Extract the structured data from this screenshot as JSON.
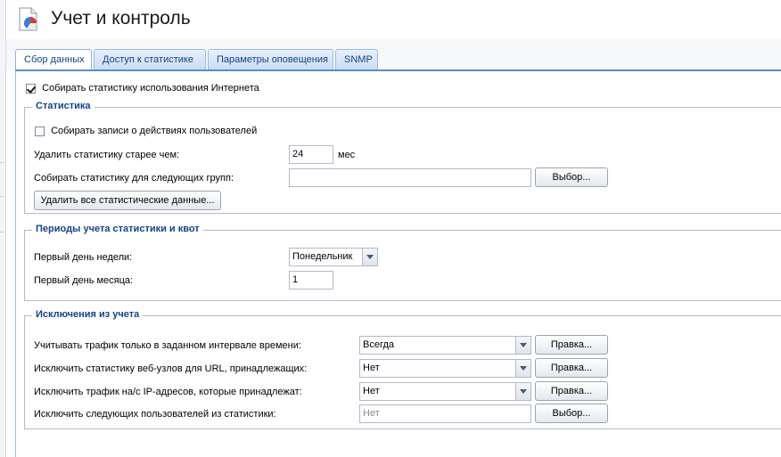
{
  "header": {
    "title": "Учет и контроль"
  },
  "tabs": [
    {
      "label": "Сбор данных",
      "active": true
    },
    {
      "label": "Доступ к статистике"
    },
    {
      "label": "Параметры оповещения"
    },
    {
      "label": "SNMP"
    }
  ],
  "collect": {
    "label": "Собирать статистику использования Интернета",
    "checked": true
  },
  "stats_group": {
    "title": "Статистика",
    "record_actions_label": "Собирать записи о действиях пользователей",
    "delete_older_label": "Удалить статистику старее чем:",
    "delete_older_value": "24",
    "delete_older_unit": "мес",
    "groups_label": "Собирать статистику для следующих групп:",
    "groups_value": "",
    "choose_button": "Выбор...",
    "delete_all_button": "Удалить все статистические данные..."
  },
  "periods_group": {
    "title": "Периоды учета статистики и квот",
    "week_day_label": "Первый день недели:",
    "week_day_value": "Понедельник",
    "month_day_label": "Первый день месяца:",
    "month_day_value": "1"
  },
  "exclusions_group": {
    "title": "Исключения из учета",
    "rows": [
      {
        "label": "Учитывать трафик только в заданном интервале времени:",
        "value": "Всегда",
        "button": "Правка..."
      },
      {
        "label": "Исключить статистику веб-узлов для URL, принадлежащих:",
        "value": "Нет",
        "button": "Правка..."
      },
      {
        "label": "Исключить трафик на/с IP-адресов, которые принадлежат:",
        "value": "Нет",
        "button": "Правка..."
      }
    ],
    "users_label": "Исключить следующих пользователей из статистики:",
    "users_placeholder": "Нет",
    "users_button": "Выбор..."
  },
  "colors": {
    "accent": "#15428b",
    "tab_border": "#99bbe8"
  }
}
